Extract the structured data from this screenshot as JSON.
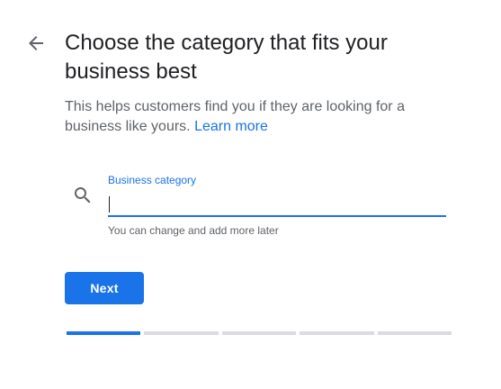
{
  "header": {
    "title": "Choose the category that fits your business best",
    "subtitle": "This helps customers find you if they are looking for a business like yours.",
    "learn_more": "Learn more"
  },
  "category_field": {
    "label": "Business category",
    "value": "",
    "helper": "You can change and add more later"
  },
  "actions": {
    "next_label": "Next"
  },
  "progress": {
    "total_steps": 5,
    "current_step": 1
  },
  "icons": {
    "back": "arrow-back-icon",
    "search": "search-icon"
  },
  "colors": {
    "accent": "#1a73e8",
    "inactive_track": "#dadce0",
    "title_text": "#202124",
    "secondary_text": "#5f6368"
  }
}
